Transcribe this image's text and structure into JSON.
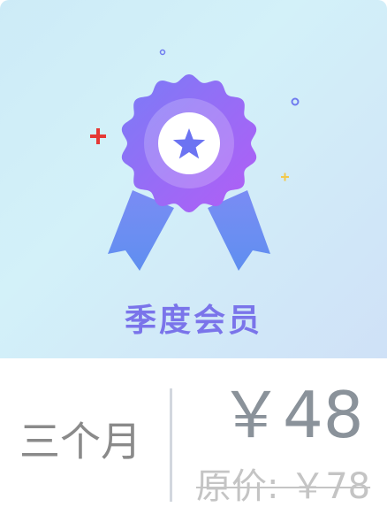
{
  "plan": {
    "title": "季度会员",
    "duration": "三个月",
    "price": "￥48",
    "original_price": "原价: ￥78"
  },
  "icons": {
    "badge": "ribbon-medal-star-icon",
    "sparkles": [
      "plus-sparkle-icon",
      "circle-sparkle-icon"
    ]
  },
  "colors": {
    "banner_bg": "#d3f1f9",
    "badge_purple": "#9b6cf6",
    "ribbon_blue": "#6c8ef2",
    "title": "#7a74ea",
    "price_text": "#8a929a",
    "original_price_text": "#c4c4c4",
    "sparkle_red": "#e53935",
    "sparkle_yellow": "#f2c94c"
  }
}
